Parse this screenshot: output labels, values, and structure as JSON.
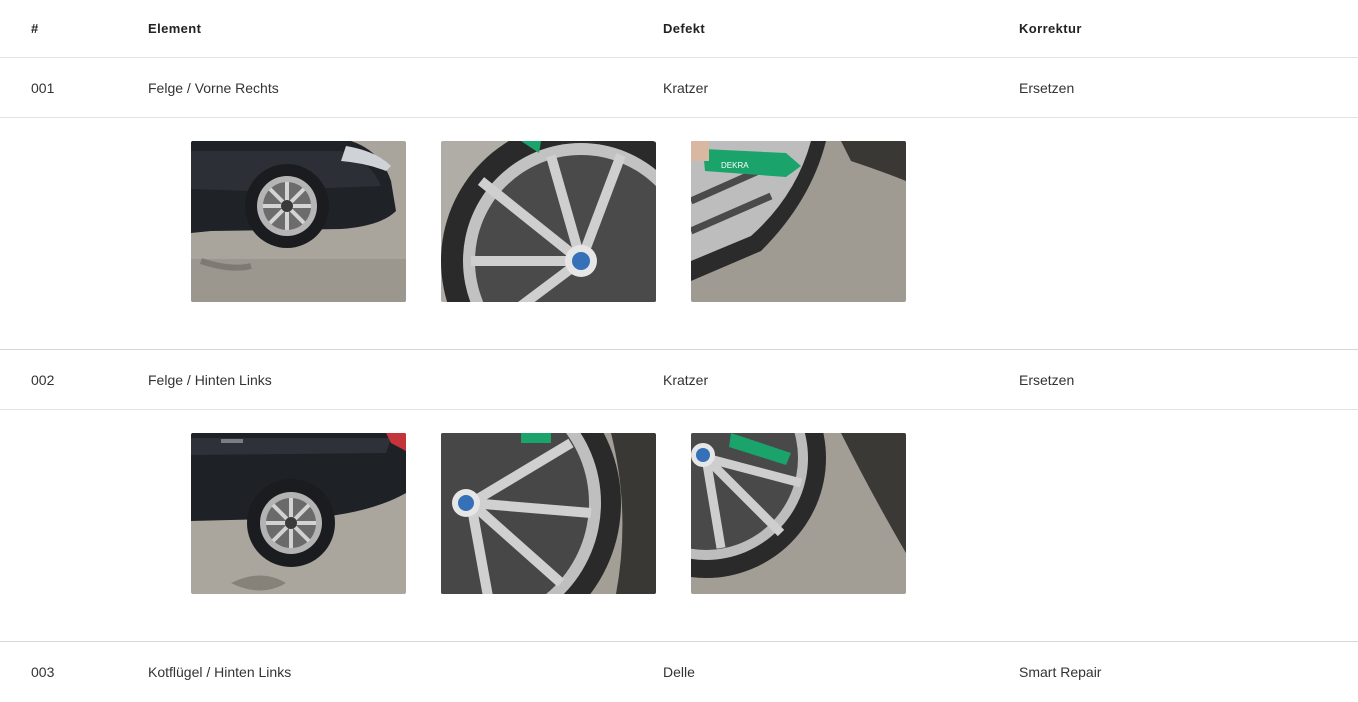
{
  "columns": {
    "num": "#",
    "element": "Element",
    "defect": "Defekt",
    "correction": "Korrektur"
  },
  "rows": [
    {
      "num": "001",
      "element": "Felge / Vorne Rechts",
      "defect": "Kratzer",
      "correction": "Ersetzen",
      "photos": [
        "car-side-front-wheel-photo",
        "wheel-rim-closeup-photo",
        "rim-scratch-marker-photo"
      ]
    },
    {
      "num": "002",
      "element": "Felge / Hinten Links",
      "defect": "Kratzer",
      "correction": "Ersetzen",
      "photos": [
        "car-side-rear-wheel-photo",
        "wheel-rim-closeup-photo",
        "rim-scratch-marker-photo"
      ]
    },
    {
      "num": "003",
      "element": "Kotflügel / Hinten Links",
      "defect": "Delle",
      "correction": "Smart Repair"
    }
  ],
  "marker_text": "DEKRA",
  "colors": {
    "row_border": "#e3e3e3",
    "car_body": "#1f2226",
    "asphalt": "#a7a39b",
    "rim_silver": "#c9c9c9",
    "marker_green": "#1aa36a"
  }
}
